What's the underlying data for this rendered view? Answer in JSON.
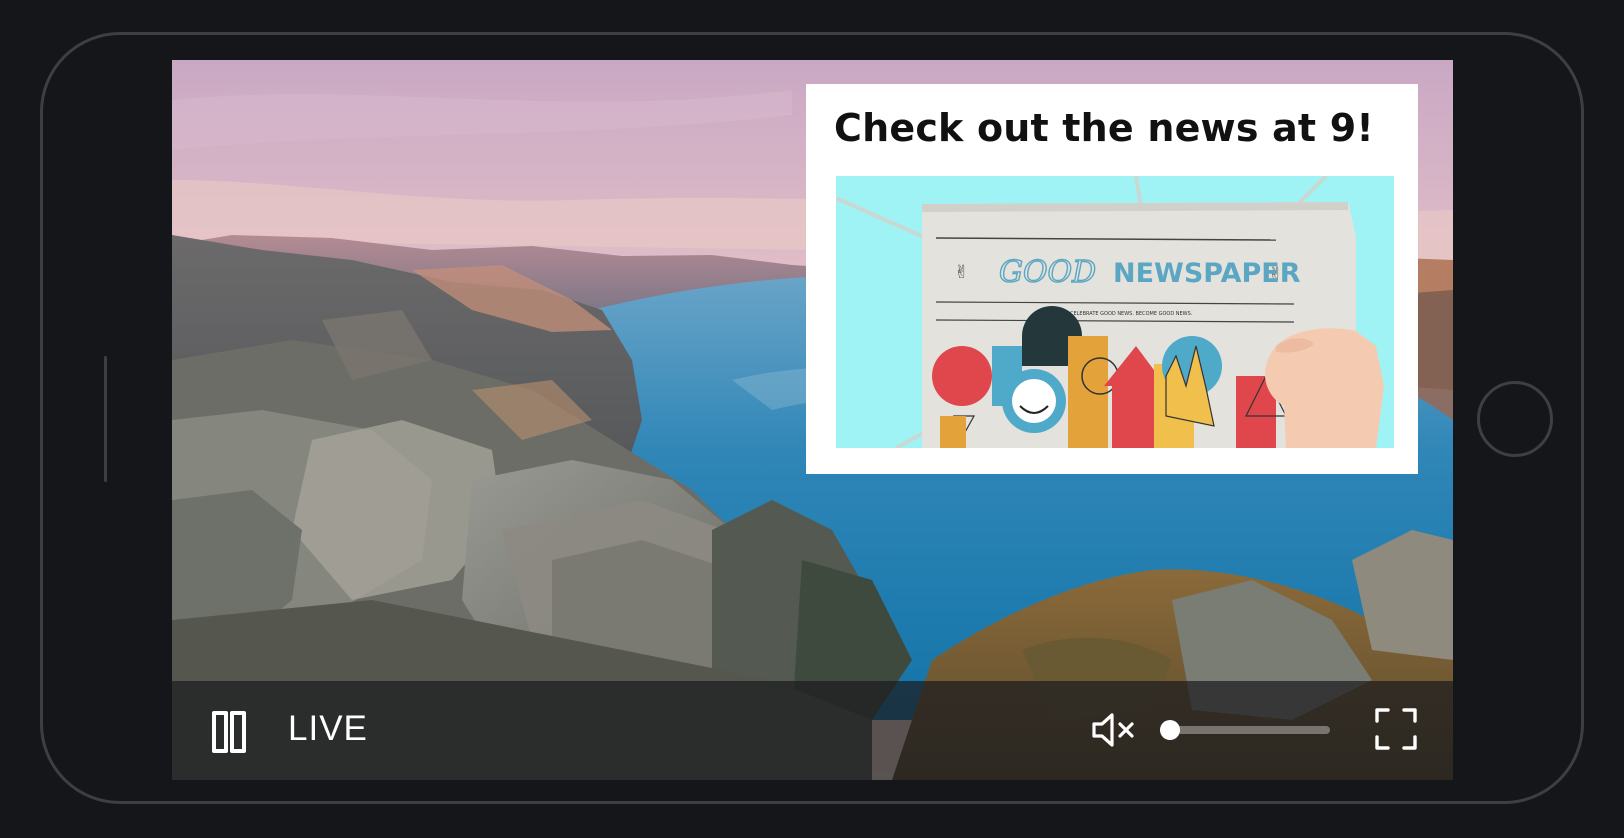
{
  "video": {
    "status_label": "LIVE",
    "volume_level": 0
  },
  "ad": {
    "title": "Check out the news at 9!",
    "image": {
      "masthead_script": "GOOD",
      "masthead": "NEWSPAPER",
      "tagline": "CELEBRATE GOOD NEWS. BECOME GOOD NEWS."
    }
  },
  "controls": {
    "play_state": "playing",
    "muted": true,
    "icons": [
      "pause-icon",
      "volume-muted-icon",
      "fullscreen-icon"
    ]
  },
  "colors": {
    "control_bar_bg": "#1c1c1e",
    "ad_image_bg": "#9ff3f4",
    "masthead_color": "#5ba6c2",
    "accent_icon": "#ffffff"
  }
}
